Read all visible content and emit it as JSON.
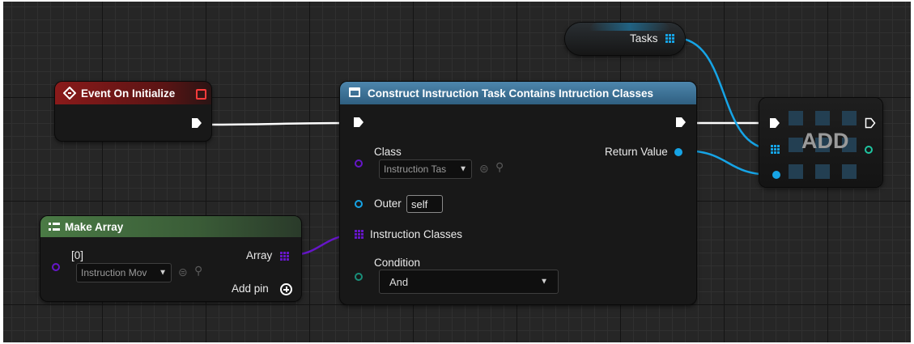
{
  "nodes": {
    "tasks_getter": {
      "label": "Tasks"
    },
    "event": {
      "title": "Event On Initialize"
    },
    "construct": {
      "title": "Construct Instruction Task Contains Intruction Classes",
      "class_label": "Class",
      "class_value": "Instruction Tas",
      "return_label": "Return Value",
      "outer_label": "Outer",
      "outer_value": "self",
      "instruction_classes_label": "Instruction Classes",
      "condition_label": "Condition",
      "condition_value": "And"
    },
    "make_array": {
      "title": "Make Array",
      "index_label": "[0]",
      "item_value": "Instruction Mov",
      "array_label": "Array",
      "add_pin_label": "Add pin"
    },
    "add": {
      "label": "ADD"
    }
  },
  "colors": {
    "background": "#262626",
    "event_header": "#8a1a1a",
    "construct_header": "#3b6f91",
    "make_array_header": "#3f6e3b",
    "exec_wire": "#ffffff",
    "object_wire": "#16a4e6",
    "class_wire": "#6616c8"
  },
  "icons": {
    "event": "event-diamond-icon",
    "construct": "function-icon",
    "make_array": "array-icon",
    "delegate": "delegate-square-icon",
    "browse": "browse-arrow-icon",
    "search": "search-icon",
    "add_pin": "plus-circle-icon",
    "dropdown": "chevron-down-icon"
  }
}
